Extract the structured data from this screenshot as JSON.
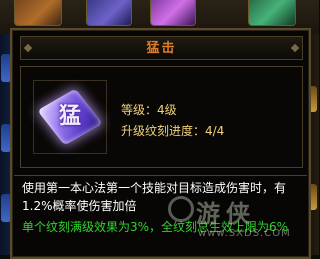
{
  "tooltip": {
    "title": "猛击",
    "skill_glyph": "猛",
    "level_text": "等级：4级",
    "engrave_progress_text": "升级纹刻进度：4/4",
    "description": "使用第一本心法第一个技能对目标造成伤害时，有1.2%概率使伤害加倍",
    "bonus": "单个纹刻满级效果为3%，全纹刻总生效上限为6%"
  },
  "watermark": {
    "site_cn": "游侠",
    "url": "www.SXDS.COM"
  },
  "colors": {
    "title": "#e07c28",
    "stat": "#f0d27a",
    "description": "#ffffff",
    "bonus": "#2fd22f",
    "border": "#5a4a2c"
  },
  "icons": {
    "skill": "purple-crystal-skill-icon",
    "watermark_logo": "circle-logo-icon"
  }
}
